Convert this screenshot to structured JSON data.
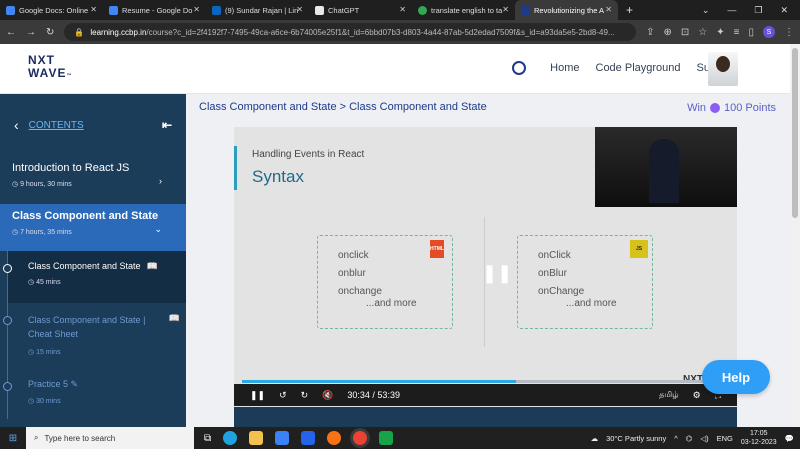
{
  "browser": {
    "tabs": [
      {
        "title": "Google Docs: Online",
        "color": "#4285f4"
      },
      {
        "title": "Resume - Google Do",
        "color": "#4285f4"
      },
      {
        "title": "(9) Sundar Rajan | Lin",
        "color": "#0a66c2"
      },
      {
        "title": "ChatGPT",
        "color": "#e8e8e8"
      },
      {
        "title": "translate english to ta",
        "color": "#34a853"
      },
      {
        "title": "Revolutionizing the A",
        "color": "#1e3a8a"
      }
    ],
    "url_domain": "learning.ccbp.in",
    "url_rest": "/course?c_id=2f4192f7-7495-49ca-a6ce-6b74005e25f1&t_id=6bbd07b3-d803-4a44-87ab-5d2edad7509f&s_id=a93da5e5-2bd8-49...",
    "profile_initial": "S"
  },
  "header": {
    "logo_line1": "NXT",
    "logo_line2": "WAVE",
    "nav": [
      "Home",
      "Code Playground",
      "Sundar"
    ]
  },
  "sidebar": {
    "title": "CONTENTS",
    "modules": [
      {
        "title": "Introduction to React JS",
        "duration": "9 hours, 30 mins"
      },
      {
        "title": "Class Component and State",
        "duration": "7 hours, 35 mins"
      }
    ],
    "lessons": [
      {
        "title": "Class Component and State",
        "duration": "45 mins"
      },
      {
        "title": "Class Component and State | Cheat Sheet",
        "duration": "15 mins"
      },
      {
        "title": "Practice 5",
        "duration": "30 mins"
      }
    ]
  },
  "content": {
    "breadcrumb": "Class Component and State > Class Component and State",
    "win_label": "Win",
    "points": "100 Points"
  },
  "video": {
    "subtitle": "Handling Events in React",
    "title": "Syntax",
    "html_events": [
      "onclick",
      "onblur",
      "onchange"
    ],
    "js_events": [
      "onClick",
      "onBlur",
      "onChange"
    ],
    "more": "...and more",
    "html_badge": "HTML",
    "js_badge": "JS",
    "progress_fraction": 0.57,
    "time": "30:34  /  53:39",
    "language": "தமிழ்",
    "logo": "NXT WAVE"
  },
  "help_label": "Help",
  "taskbar": {
    "search_placeholder": "Type here to search",
    "weather": "30°C  Partly sunny",
    "lang": "ENG",
    "time": "17:05",
    "date": "03-12-2023"
  }
}
